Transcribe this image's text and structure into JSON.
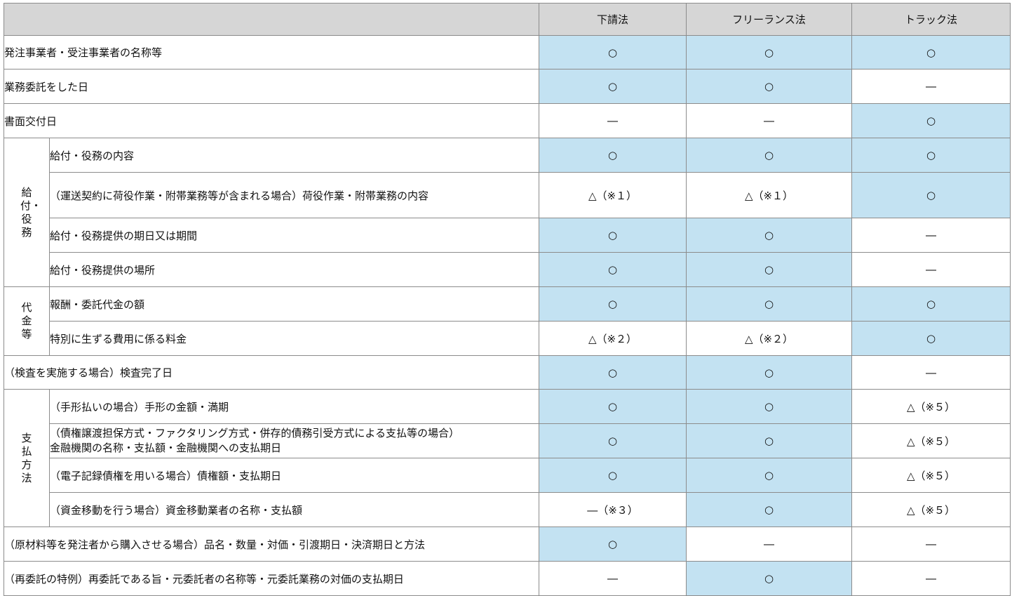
{
  "headers": [
    "下請法",
    "フリーランス法",
    "トラック法"
  ],
  "groups": {
    "g1": "給付・役務",
    "g2": "代金等",
    "g3": "支払方法"
  },
  "rows": [
    {
      "label": "発注事業者・受注事業者の名称等",
      "values": [
        "○",
        "○",
        "○"
      ]
    },
    {
      "label": "業務委託をした日",
      "values": [
        "○",
        "○",
        "―"
      ]
    },
    {
      "label": "書面交付日",
      "values": [
        "―",
        "―",
        "○"
      ]
    },
    {
      "label": "給付・役務の内容",
      "values": [
        "○",
        "○",
        "○"
      ]
    },
    {
      "label": "（運送契約に荷役作業・附帯業務等が含まれる場合）荷役作業・附帯業務の内容",
      "values": [
        "△（※１）",
        "△（※１）",
        "○"
      ]
    },
    {
      "label": "給付・役務提供の期日又は期間",
      "values": [
        "○",
        "○",
        "―"
      ]
    },
    {
      "label": "給付・役務提供の場所",
      "values": [
        "○",
        "○",
        "―"
      ]
    },
    {
      "label": "報酬・委託代金の額",
      "values": [
        "○",
        "○",
        "○"
      ]
    },
    {
      "label": "特別に生ずる費用に係る料金",
      "values": [
        "△（※２）",
        "△（※２）",
        "○"
      ]
    },
    {
      "label": "（検査を実施する場合）検査完了日",
      "values": [
        "○",
        "○",
        "―"
      ]
    },
    {
      "label": "（手形払いの場合）手形の金額・満期",
      "values": [
        "○",
        "○",
        "△（※５）"
      ]
    },
    {
      "label": "（債権譲渡担保方式・ファクタリング方式・併存的債務引受方式による支払等の場合）",
      "label2": "金融機関の名称・支払額・金融機関への支払期日",
      "values": [
        "○",
        "○",
        "△（※５）"
      ]
    },
    {
      "label": "（電子記録債権を用いる場合）債権額・支払期日",
      "values": [
        "○",
        "○",
        "△（※５）"
      ]
    },
    {
      "label": "（資金移動を行う場合）資金移動業者の名称・支払額",
      "values": [
        "―（※３）",
        "○",
        "△（※５）"
      ]
    },
    {
      "label": "（原材料等を発注者から購入させる場合）品名・数量・対価・引渡期日・決済期日と方法",
      "values": [
        "○",
        "―",
        "―"
      ]
    },
    {
      "label": "（再委託の特例）再委託である旨・元委託者の名称等・元委託業務の対価の支払期日",
      "values": [
        "―",
        "○",
        "―"
      ]
    }
  ]
}
